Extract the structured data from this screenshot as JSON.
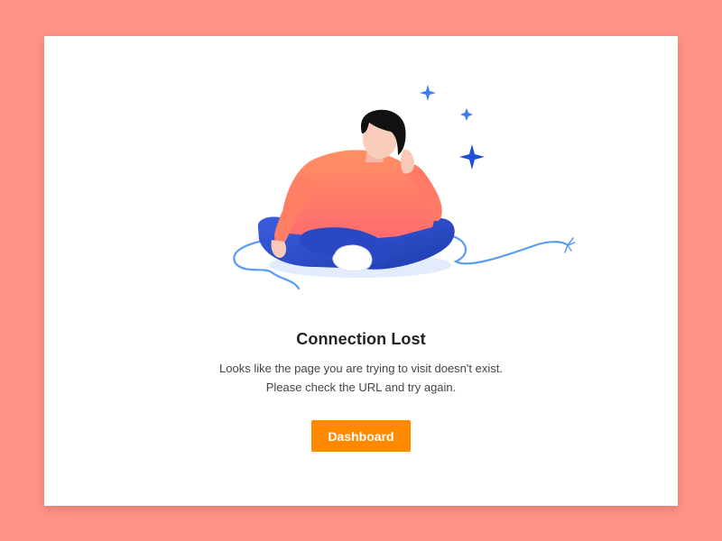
{
  "colors": {
    "background": "#ff9286",
    "card": "#ffffff",
    "accent": "#ff8a00",
    "sparkle": "#2f6fe0",
    "cable": "#5b9cf0",
    "pants": "#2a4bc8",
    "sweater_top": "#ff8a6a",
    "sweater_bottom": "#ff6f6a"
  },
  "illustration": {
    "icon": "person-sitting-with-unplugged-cable-illustration"
  },
  "error": {
    "title": "Connection Lost",
    "message_line1": "Looks like the page you are trying to visit doesn't exist.",
    "message_line2": "Please check the URL and try again."
  },
  "actions": {
    "dashboard_label": "Dashboard"
  }
}
